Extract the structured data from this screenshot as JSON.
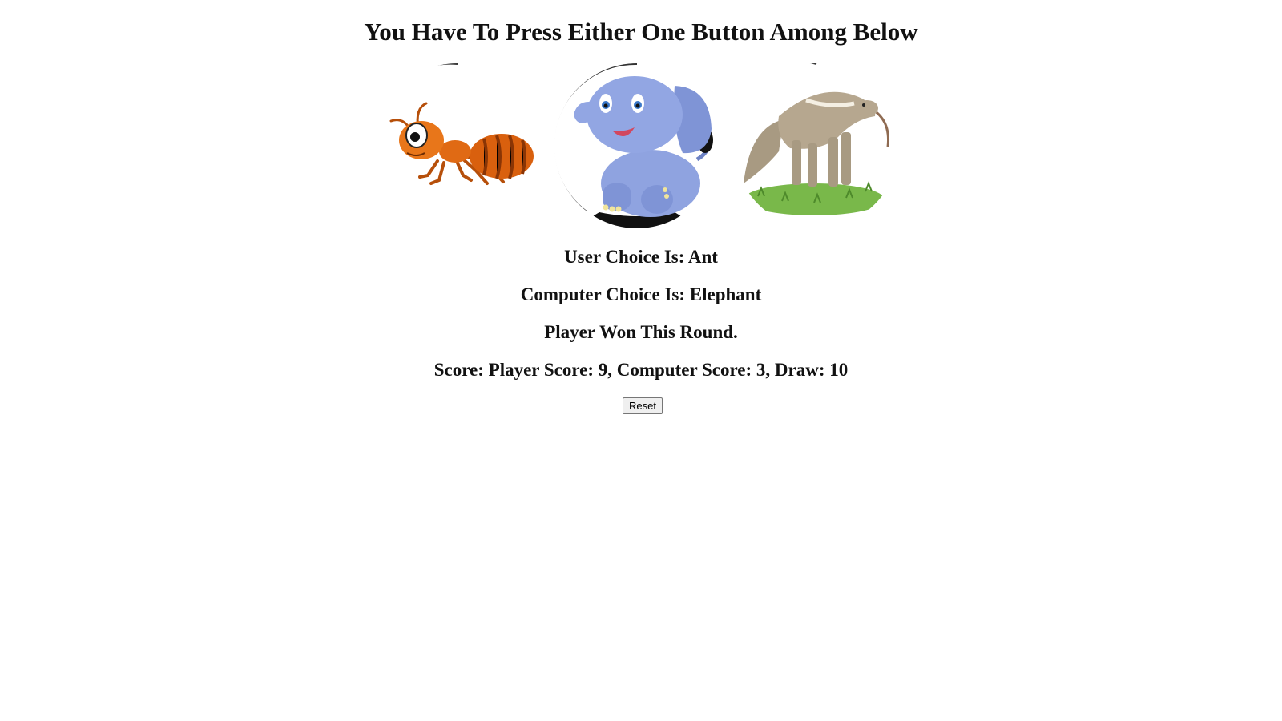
{
  "game": {
    "title": "You Have To Press Either One Button Among Below",
    "choices": [
      {
        "name": "Ant",
        "icon": "ant-icon"
      },
      {
        "name": "Elephant",
        "icon": "elephant-icon"
      },
      {
        "name": "Anteater",
        "icon": "anteater-icon"
      }
    ],
    "user_choice_text": "User Choice Is: Ant",
    "computer_choice_text": "Computer Choice Is: Elephant",
    "round_result_text": "Player Won This Round.",
    "score_text": "Score: Player Score: 9, Computer Score: 3, Draw: 10",
    "reset_label": "Reset"
  },
  "colors": {
    "ant_body": "#d9600e",
    "elephant_body": "#8fa3e0",
    "anteater_body": "#b6a78f",
    "grass": "#79b84a"
  }
}
